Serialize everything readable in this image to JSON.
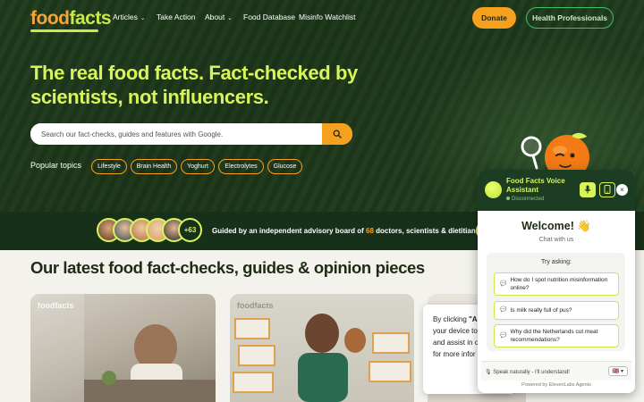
{
  "brand": {
    "logo_food": "food",
    "logo_facts": "facts"
  },
  "nav": {
    "items": [
      {
        "label": "Articles",
        "has_dropdown": true
      },
      {
        "label": "Take Action",
        "has_dropdown": false
      },
      {
        "label": "About",
        "has_dropdown": true
      },
      {
        "label": "Food Database",
        "has_dropdown": false
      },
      {
        "label": "Misinfo Watchlist",
        "has_dropdown": false
      }
    ],
    "chevron": "⌄"
  },
  "header_buttons": {
    "donate": "Donate",
    "health_professionals": "Health Professionals"
  },
  "hero": {
    "headline": "The real food facts. Fact-checked by scientists, not influencers.",
    "search_placeholder": "Search our fact-checks, guides and features with Google.",
    "search_icon": "search-icon",
    "popular_label": "Popular topics",
    "topics": [
      "Lifestyle",
      "Brain Health",
      "Yoghurt",
      "Electrolytes",
      "Glucose"
    ]
  },
  "advisory": {
    "extra_count": "+63",
    "text_before": "Guided by an independent advisory board of ",
    "text_number": "68",
    "text_after": " doctors, scientists & dietitians"
  },
  "latest": {
    "title": "Our latest food fact-checks, guides & opinion pieces",
    "card_logo": "foodfacts"
  },
  "cookie": {
    "line1_prefix": "By clicking ",
    "line1_bold": "\"Ac",
    "line2": "your device to",
    "line3": "and assist in o",
    "line4": "for more infor"
  },
  "widget": {
    "title": "Food Facts Voice Assistant",
    "status": "Disconnected",
    "mic_icon": "mic-icon",
    "phone_icon": "phone-icon",
    "close": "×",
    "welcome": "Welcome! 👋",
    "chat_with_us": "Chat with us",
    "try_asking": "Try asking:",
    "suggestions": [
      "How do I spot nutrition misinformation online?",
      "Is milk really full of pus?",
      "Why did the Netherlands cut meat recommendations?"
    ],
    "speak_hint": "Speak naturally - I'll understand!",
    "language": "🇬🇧 ▾",
    "powered_by": "Powered by ElevenLabs Agents"
  },
  "colors": {
    "hero_bg": "#1f3a1c",
    "accent_lime": "#d9f45a",
    "accent_orange": "#f5a01e",
    "health_border": "#3fbf6a",
    "page_bg": "#f3f2ec"
  }
}
